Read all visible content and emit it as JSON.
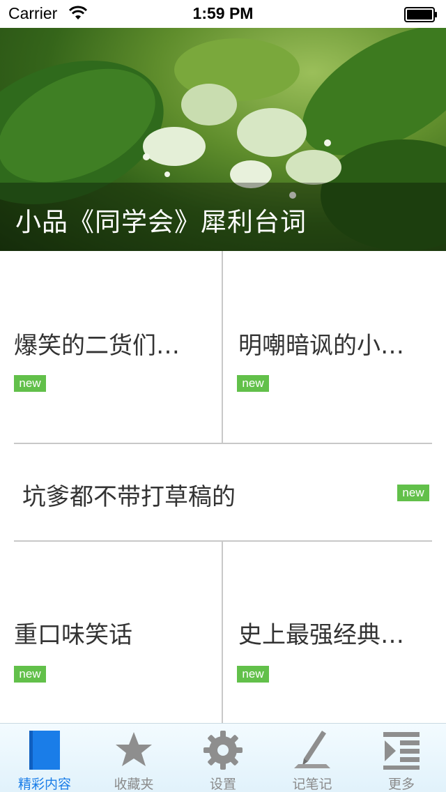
{
  "status_bar": {
    "carrier": "Carrier",
    "time": "1:59 PM"
  },
  "hero": {
    "caption": "小品《同学会》犀利台词"
  },
  "grid": {
    "items": [
      {
        "title": "爆笑的二货们…",
        "badge": "new"
      },
      {
        "title": "明嘲暗讽的小…",
        "badge": "new"
      },
      {
        "title": "坑爹都不带打草稿的",
        "badge": "new"
      },
      {
        "title": "重口味笑话",
        "badge": "new"
      },
      {
        "title": "史上最强经典…",
        "badge": "new"
      }
    ]
  },
  "tabbar": {
    "tabs": [
      {
        "label": "精彩内容",
        "icon": "book-icon",
        "active": true
      },
      {
        "label": "收藏夹",
        "icon": "star-icon"
      },
      {
        "label": "设置",
        "icon": "gear-icon"
      },
      {
        "label": "记笔记",
        "icon": "pencil-icon"
      },
      {
        "label": "更多",
        "icon": "more-list-icon"
      }
    ]
  },
  "colors": {
    "badge": "#62c04a",
    "active_tab": "#1a7de8",
    "inactive_tab": "#8a8a8a"
  }
}
